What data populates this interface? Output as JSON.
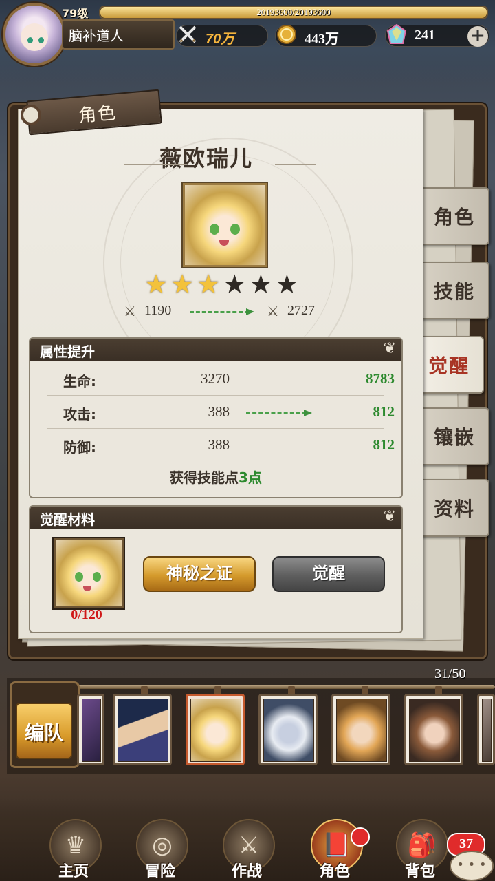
{
  "player": {
    "level": "79级",
    "exp": "20193600/20193600",
    "exp_fraction": 1.0,
    "name": "脑补道人",
    "power": "70万",
    "gold": "443万",
    "gems": "241"
  },
  "icons": {
    "power": "crossed-swords-icon",
    "gold": "gold-coin-icon",
    "gem": "rainbow-crystal-icon",
    "add": "plus-icon"
  },
  "panel": {
    "tab_title": "角色",
    "hero_name": "薇欧瑞儿",
    "stars_on": 3,
    "stars_total": 6,
    "power_from": "1190",
    "power_to": "2727"
  },
  "attributes": {
    "title": "属性提升",
    "rows": [
      {
        "label": "生命:",
        "from": "3270",
        "to": "8783"
      },
      {
        "label": "攻击:",
        "from": "388",
        "to": "812"
      },
      {
        "label": "防御:",
        "from": "388",
        "to": "812"
      }
    ],
    "skill_prefix": "获得技能点",
    "skill_value": "3点"
  },
  "materials": {
    "title": "觉醒材料",
    "count": "0/120",
    "btn_proof": "神秘之证",
    "btn_awaken": "觉醒"
  },
  "side_tabs": [
    {
      "label": "角色",
      "active": false
    },
    {
      "label": "技能",
      "active": false
    },
    {
      "label": "觉醒",
      "active": true
    },
    {
      "label": "镶嵌",
      "active": false
    },
    {
      "label": "资料",
      "active": false
    }
  ],
  "roster": {
    "count": "31/50",
    "team_label": "编队"
  },
  "nav": [
    {
      "label": "主页",
      "icon": "statue-icon"
    },
    {
      "label": "冒险",
      "icon": "portal-icon"
    },
    {
      "label": "作战",
      "icon": "battle-icon"
    },
    {
      "label": "角色",
      "icon": "book-icon"
    },
    {
      "label": "背包",
      "icon": "bag-icon"
    }
  ],
  "badges": {
    "bag": "37"
  }
}
